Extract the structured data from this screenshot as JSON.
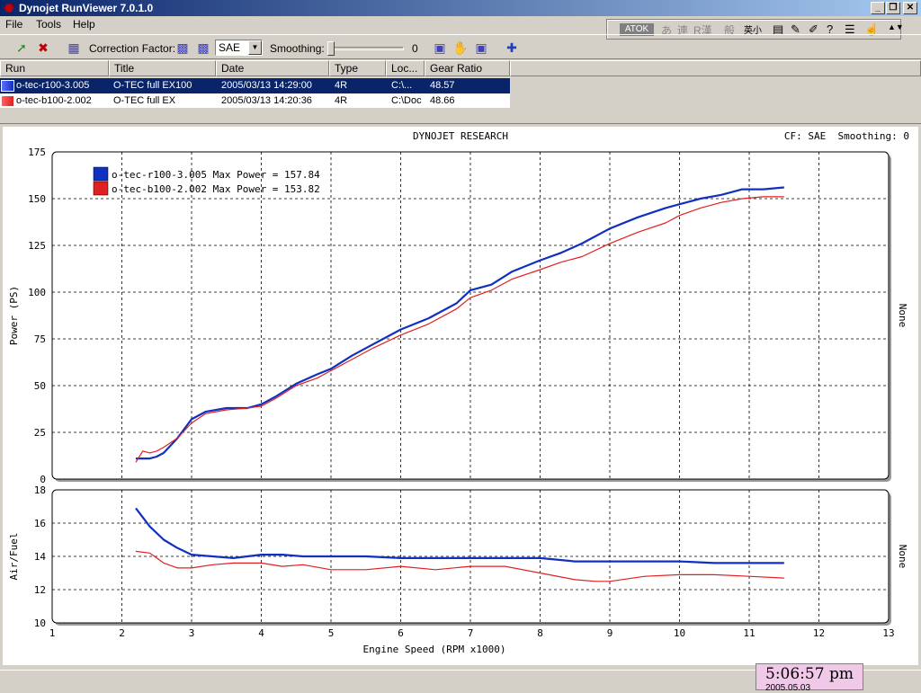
{
  "window": {
    "title": "Dynojet RunViewer 7.0.1.0"
  },
  "menu": {
    "file": "File",
    "tools": "Tools",
    "help": "Help"
  },
  "toolbar": {
    "correction_label": "Correction Factor:",
    "correction_value": "SAE",
    "smoothing_label": "Smoothing:",
    "smoothing_value": "0"
  },
  "ime": {
    "atok": "ATOK",
    "k1": "あ",
    "k2": "連",
    "k3": "R漢",
    "k4": "般",
    "k5": "英小"
  },
  "list": {
    "headers": [
      "Run",
      "Title",
      "Date",
      "Type",
      "Loc...",
      "Gear Ratio"
    ],
    "rows": [
      {
        "run": "o-tec-r100-3.005",
        "title": "O-TEC full EX100",
        "date": "2005/03/13 14:29:00",
        "type": "4R",
        "loc": "C:\\...",
        "gear": "48.57",
        "color": "#1030c0",
        "selected": true
      },
      {
        "run": "o-tec-b100-2.002",
        "title": "O-TEC full EX",
        "date": "2005/03/13 14:20:36",
        "type": "4R",
        "loc": "C:\\Doc",
        "gear": "48.66",
        "color": "#e02020",
        "selected": false
      }
    ]
  },
  "chart_header": {
    "title": "DYNOJET RESEARCH",
    "info": "CF: SAE  Smoothing: 0"
  },
  "chart_data": [
    {
      "type": "line",
      "title": "DYNOJET RESEARCH",
      "ylabel": "Power (PS)",
      "right_label": "None",
      "ylim": [
        0,
        175
      ],
      "yticks": [
        0,
        25,
        50,
        75,
        100,
        125,
        150,
        175
      ],
      "xlim": [
        1,
        13
      ],
      "grid": true,
      "legend_position": "top-left",
      "legend": [
        "o-tec-r100-3.005 Max Power = 157.84",
        "o-tec-b100-2.002 Max Power = 153.82"
      ],
      "series": [
        {
          "name": "o-tec-r100-3.005",
          "color": "#1030c0",
          "x": [
            2.2,
            2.3,
            2.4,
            2.5,
            2.6,
            2.8,
            3.0,
            3.2,
            3.5,
            3.8,
            4.0,
            4.2,
            4.5,
            4.8,
            5.0,
            5.3,
            5.6,
            6.0,
            6.4,
            6.8,
            7.0,
            7.3,
            7.6,
            8.0,
            8.3,
            8.6,
            9.0,
            9.4,
            9.8,
            10.0,
            10.3,
            10.6,
            10.9,
            11.2,
            11.5
          ],
          "y": [
            11,
            11,
            11,
            12,
            14,
            22,
            32,
            36,
            38,
            38,
            40,
            44,
            51,
            56,
            59,
            66,
            72,
            80,
            86,
            94,
            101,
            104,
            111,
            117,
            121,
            126,
            134,
            140,
            145,
            147,
            150,
            152,
            155,
            155,
            156
          ]
        },
        {
          "name": "o-tec-b100-2.002",
          "color": "#e02020",
          "x": [
            2.2,
            2.3,
            2.4,
            2.5,
            2.6,
            2.8,
            3.0,
            3.2,
            3.5,
            3.8,
            4.0,
            4.2,
            4.5,
            4.8,
            5.0,
            5.3,
            5.6,
            6.0,
            6.4,
            6.8,
            7.0,
            7.3,
            7.6,
            8.0,
            8.3,
            8.6,
            9.0,
            9.4,
            9.8,
            10.0,
            10.3,
            10.6,
            10.9,
            11.2,
            11.5
          ],
          "y": [
            9,
            15,
            14,
            15,
            17,
            22,
            30,
            35,
            37,
            38,
            39,
            43,
            50,
            54,
            58,
            64,
            70,
            77,
            83,
            91,
            97,
            101,
            107,
            112,
            116,
            119,
            126,
            132,
            137,
            141,
            145,
            148,
            150,
            151,
            151
          ]
        }
      ]
    },
    {
      "type": "line",
      "xlabel": "Engine Speed (RPM x1000)",
      "ylabel": "Air/Fuel",
      "right_label": "None",
      "ylim": [
        10,
        18
      ],
      "yticks": [
        10,
        12,
        14,
        16,
        18
      ],
      "xlim": [
        1,
        13
      ],
      "xticks": [
        1,
        2,
        3,
        4,
        5,
        6,
        7,
        8,
        9,
        10,
        11,
        12,
        13
      ],
      "grid": true,
      "series": [
        {
          "name": "o-tec-r100-3.005",
          "color": "#1030c0",
          "x": [
            2.2,
            2.4,
            2.6,
            2.8,
            3.0,
            3.3,
            3.6,
            4.0,
            4.3,
            4.6,
            5.0,
            5.5,
            6.0,
            6.5,
            7.0,
            7.5,
            8.0,
            8.5,
            9.0,
            9.5,
            10.0,
            10.5,
            11.0,
            11.5
          ],
          "y": [
            16.9,
            15.8,
            15.0,
            14.5,
            14.1,
            14.0,
            13.9,
            14.1,
            14.1,
            14.0,
            14.0,
            14.0,
            13.9,
            13.9,
            13.9,
            13.9,
            13.9,
            13.7,
            13.7,
            13.7,
            13.7,
            13.6,
            13.6,
            13.6
          ]
        },
        {
          "name": "o-tec-b100-2.002",
          "color": "#e02020",
          "x": [
            2.2,
            2.4,
            2.6,
            2.8,
            3.0,
            3.3,
            3.6,
            4.0,
            4.3,
            4.6,
            5.0,
            5.5,
            6.0,
            6.5,
            7.0,
            7.5,
            8.0,
            8.5,
            8.8,
            9.0,
            9.5,
            10.0,
            10.5,
            11.0,
            11.5
          ],
          "y": [
            14.3,
            14.2,
            13.6,
            13.3,
            13.3,
            13.5,
            13.6,
            13.6,
            13.4,
            13.5,
            13.2,
            13.2,
            13.4,
            13.2,
            13.4,
            13.4,
            13.0,
            12.6,
            12.5,
            12.5,
            12.8,
            12.9,
            12.9,
            12.8,
            12.7
          ]
        }
      ]
    }
  ],
  "clock": {
    "time": "5:06:57 pm",
    "date": "2005.05.03"
  }
}
